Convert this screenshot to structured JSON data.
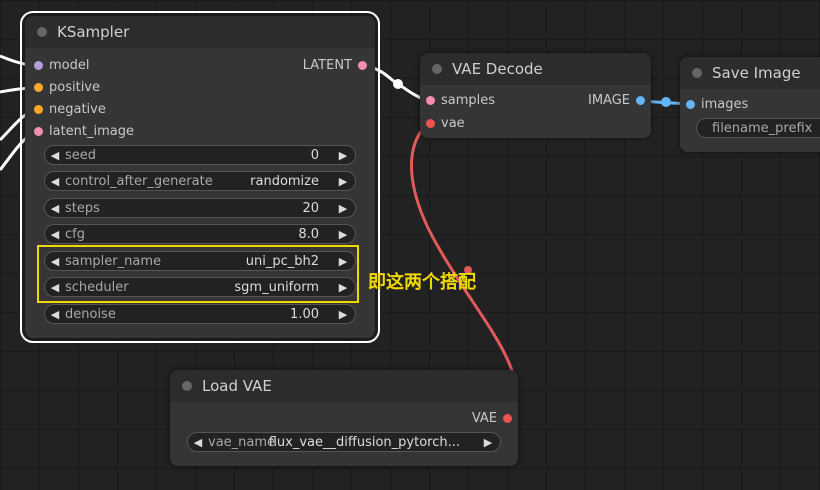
{
  "ksampler": {
    "title": "KSampler",
    "inputs": [
      {
        "label": "model",
        "color": "#b39ddb"
      },
      {
        "label": "positive",
        "color": "#ffa726"
      },
      {
        "label": "negative",
        "color": "#ffa726"
      },
      {
        "label": "latent_image",
        "color": "#f48fb1"
      }
    ],
    "output": {
      "label": "LATENT",
      "color": "#f48fb1"
    },
    "widgets": [
      {
        "name": "seed",
        "value": "0"
      },
      {
        "name": "control_after_generate",
        "value": "randomize"
      },
      {
        "name": "steps",
        "value": "20"
      },
      {
        "name": "cfg",
        "value": "8.0"
      },
      {
        "name": "sampler_name",
        "value": "uni_pc_bh2"
      },
      {
        "name": "scheduler",
        "value": "sgm_uniform"
      },
      {
        "name": "denoise",
        "value": "1.00"
      }
    ]
  },
  "vae_decode": {
    "title": "VAE Decode",
    "inputs": [
      {
        "label": "samples",
        "color": "#f48fb1"
      },
      {
        "label": "vae",
        "color": "#ef5350"
      }
    ],
    "output": {
      "label": "IMAGE",
      "color": "#64b5f6"
    }
  },
  "save_image": {
    "title": "Save Image",
    "inputs": [
      {
        "label": "images",
        "color": "#64b5f6"
      }
    ],
    "widget": {
      "name": "filename_prefix"
    }
  },
  "load_vae": {
    "title": "Load VAE",
    "output": {
      "label": "VAE",
      "color": "#ef5350"
    },
    "widget": {
      "name": "vae_name",
      "value": "flux_vae__diffusion_pytorch..."
    }
  },
  "annotation": "即这两个搭配",
  "colors": {
    "highlight": "#f1d800",
    "wire_latent": "#ffffff",
    "wire_image": "#64b5f6",
    "wire_vae": "#e35a5a"
  }
}
